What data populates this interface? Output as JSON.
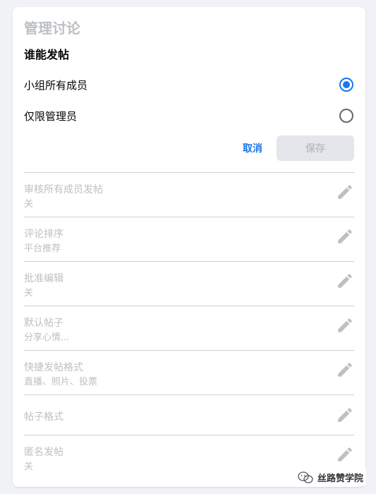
{
  "panel": {
    "title": "管理讨论",
    "who_can_post": {
      "heading": "谁能发帖",
      "options": [
        {
          "label": "小组所有成员",
          "checked": true
        },
        {
          "label": "仅限管理员",
          "checked": false
        }
      ]
    },
    "actions": {
      "cancel_label": "取消",
      "save_label": "保存"
    },
    "settings": [
      {
        "title": "审核所有成员发帖",
        "value": "关"
      },
      {
        "title": "评论排序",
        "value": "平台推荐"
      },
      {
        "title": "批准编辑",
        "value": "关"
      },
      {
        "title": "默认帖子",
        "value": "分享心情..."
      },
      {
        "title": "快捷发帖格式",
        "value": "直播、照片、投票"
      },
      {
        "title": "帖子格式",
        "value": ""
      },
      {
        "title": "匿名发帖",
        "value": "关"
      }
    ]
  },
  "watermark": {
    "text": "丝路赞学院",
    "icon": "wechat-icon"
  },
  "colors": {
    "accent": "#1877f2",
    "link": "#1b74e4",
    "disabled_text": "#bcc0c4",
    "disabled_bg": "#e4e6eb",
    "divider": "#ced0d4"
  }
}
